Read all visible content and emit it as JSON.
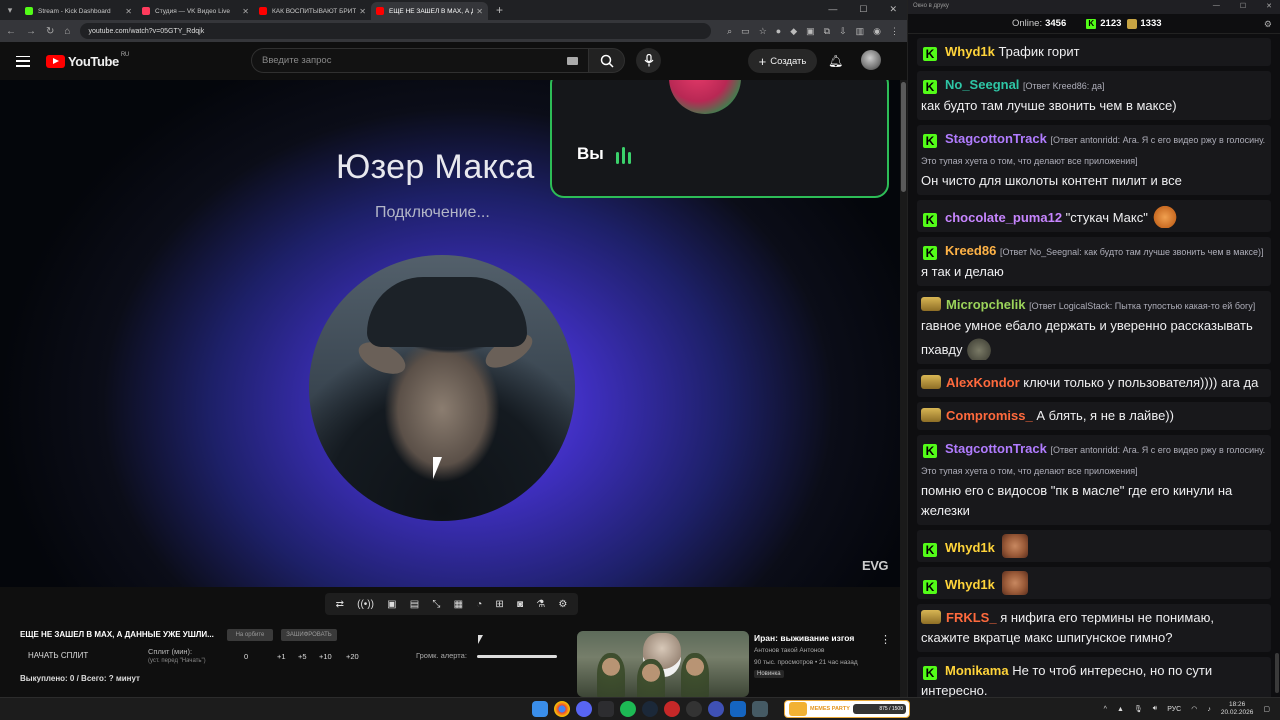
{
  "browser": {
    "tabs": [
      {
        "title": "Stream - Kick Dashboard",
        "favicon_color": "#53fc18",
        "active": false
      },
      {
        "title": "Студия — VK Видео Live",
        "favicon_color": "#ff3b5c",
        "active": false
      },
      {
        "title": "КАК ВОСПИТЫВАЮТ БРИТАН",
        "favicon_color": "#ff0000",
        "active": false
      },
      {
        "title": "ЕЩЕ НЕ ЗАШЕЛ В MAX, А Д",
        "favicon_color": "#ff0000",
        "active": true
      }
    ],
    "url": "youtube.com/watch?v=05GTY_Rdqjk"
  },
  "youtube": {
    "logo_text": "YouTube",
    "logo_region": "RU",
    "search_placeholder": "Введите запрос",
    "create_label": "Создать"
  },
  "call": {
    "caller_name": "Юзер Макса",
    "status": "Подключение...",
    "self_label": "Вы",
    "watermark": "EVG"
  },
  "under_video": {
    "title": "ЕЩЕ НЕ ЗАШЕЛ В MAX, А ДАННЫЕ УЖЕ УШЛИ...",
    "chip1": "На орбите",
    "chip2": "ЗАШИФРОВАТЬ",
    "split_button": "НАЧАТЬ СПЛИТ",
    "split_label": "Сплит (мин):",
    "split_hint": "(уст. перед \"Начать\")",
    "split_values": [
      "0",
      "+1",
      "+5",
      "+10",
      "+20"
    ],
    "alert_label": "Громк. алерта:",
    "bought": "Выкуплено: 0 / Всего: ? минут"
  },
  "recommended": {
    "title": "Иран: выживание изгоя",
    "channel": "Антонов такой Антонов",
    "meta": "90 тыс. просмотров • 21 час назад",
    "badge": "Новинка"
  },
  "chat": {
    "window_title": "Окно в друку",
    "online_label": "Online:",
    "online": "3456",
    "kick_count": "2123",
    "other_count": "1333",
    "messages": [
      {
        "user": "Whyd1k",
        "color": "#ffd43a",
        "badge": "kick",
        "text": "Трафик горит"
      },
      {
        "user": "No_Seegnal",
        "color": "#2ec6a6",
        "badge": "kick",
        "reply": "[Ответ Kreed86: да]",
        "text": "как будто там лучше звонить чем в максе)"
      },
      {
        "user": "StagcottonTrack",
        "color": "#b17cff",
        "badge": "kick",
        "reply": "[Ответ antonridd: Ага. Я с его видео ржу в голосину. Это тупая хуета о том, что делают все приложения]",
        "text": "Он чисто для школоты контент пилит и все"
      },
      {
        "user": "chocolate_puma12",
        "color": "#c785ff",
        "badge": "kick",
        "text": "\"стукач Макс\"",
        "emote": "fox"
      },
      {
        "user": "Kreed86",
        "color": "#ffb347",
        "badge": "kick",
        "reply": "[Ответ No_Seegnal: как будто там лучше звонить чем в максе)]",
        "text": "я так и делаю"
      },
      {
        "user": "Micropchelik",
        "color": "#9bd35a",
        "badge": "cup",
        "reply": "[Ответ LogicalStack: Пытка тупостью какая-то ей богу]",
        "text": "гавное умное ебало держать и уверенно рассказывать пхавду",
        "emote": "blob"
      },
      {
        "user": "AlexKondor",
        "color": "#ff6a3d",
        "badge": "cup",
        "text": "ключи только у пользователя)))) ага да"
      },
      {
        "user": "Compromiss_",
        "color": "#ff6a3d",
        "badge": "cup",
        "text": "А блять, я  не в лайве))"
      },
      {
        "user": "StagcottonTrack",
        "color": "#b17cff",
        "badge": "kick",
        "reply": "[Ответ antonridd: Ага. Я с его видео ржу в голосину. Это тупая хуета о том, что делают все приложения]",
        "text": "помню его с видосов \"пк в масле\" где его кинули на железки"
      },
      {
        "user": "Whyd1k",
        "color": "#ffd43a",
        "badge": "kick",
        "text": "",
        "emote": "face"
      },
      {
        "user": "Whyd1k",
        "color": "#ffd43a",
        "badge": "kick",
        "text": "",
        "emote": "face"
      },
      {
        "user": "FRKLS_",
        "color": "#ff6a3d",
        "badge": "cup",
        "text": "я нифига его термины не понимаю, скажите вкратце макс шпигунское гимно?"
      },
      {
        "user": "Monikama",
        "color": "#ffd43a",
        "badge": "kick",
        "text": "Не то чтоб интересно, но по сути интересно."
      }
    ]
  },
  "taskbar": {
    "memes_label": "MEMES PARTY",
    "memes_progress": "875 / 1500",
    "lang": "РУС",
    "time": "18:26",
    "date": "20.02.2026"
  }
}
